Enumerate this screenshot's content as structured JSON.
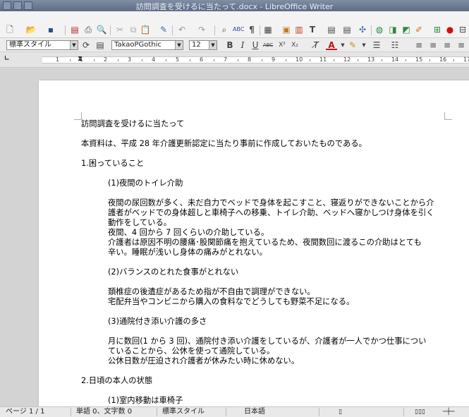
{
  "window": {
    "title": "訪問調査を受けるに当たって.docx - LibreOffice Writer"
  },
  "formatting": {
    "paragraph_style": "標準スタイル",
    "font_name": "TakaoPGothic",
    "font_size": "12",
    "bold_label": "B",
    "italic_label": "I",
    "underline_label": "U",
    "strike_label": "ABC",
    "text_color_label": "A"
  },
  "toolbar_icons": [
    "new-icon",
    "open-icon",
    "save-icon",
    "export-pdf-icon",
    "print-icon",
    "print-preview-icon",
    "cut-icon",
    "copy-icon",
    "paste-icon",
    "clone-format-icon",
    "undo-icon",
    "redo-icon",
    "find-replace-icon",
    "spelling-icon",
    "formatting-marks-icon",
    "table-icon",
    "image-icon",
    "chart-icon",
    "textbox-icon",
    "insert-field-icon",
    "footnote-icon",
    "navigator-icon",
    "hyperlink-icon",
    "comment-icon",
    "track-changes-icon",
    "record-icon"
  ],
  "ruler": {
    "numbers": [
      "1",
      "1",
      "2",
      "3",
      "4",
      "5",
      "6",
      "7",
      "8",
      "9",
      "10",
      "11",
      "12",
      "13",
      "14",
      "15",
      "16",
      "17"
    ]
  },
  "document": {
    "paragraphs": [
      {
        "text": "訪問調査を受けるに当たって",
        "indent": false
      },
      {
        "text": "",
        "indent": false
      },
      {
        "text": "本資料は、平成 28 年介護更新認定に当たり事前に作成しておいたものである。",
        "indent": false
      },
      {
        "text": "",
        "indent": false
      },
      {
        "text": "1.困っていること",
        "indent": false
      },
      {
        "text": "",
        "indent": false
      },
      {
        "text": "(1)夜間のトイレ介助",
        "indent": true
      },
      {
        "text": "",
        "indent": false
      },
      {
        "text": "夜間の尿回数が多く、未だ自力でベッドで身体を起こすこと、寝返りができないことから介",
        "indent": true
      },
      {
        "text": "護者がベッドでの身体超しと車椅子への移乗、トイレ介助、ベッドへ寝かしつけ身体を引く",
        "indent": true
      },
      {
        "text": "動作をしている。",
        "indent": true
      },
      {
        "text": "夜間、4 回から 7 回くらいの介助している。",
        "indent": true
      },
      {
        "text": "介護者は原因不明の腰痛･股関節痛を抱えているため、夜間数回に渡るこの介助はとても",
        "indent": true
      },
      {
        "text": "辛い。睡眠が浅いし身体の痛みがとれない。",
        "indent": true
      },
      {
        "text": "",
        "indent": false
      },
      {
        "text": "(2)バランスのとれた食事がとれない",
        "indent": true
      },
      {
        "text": "",
        "indent": false
      },
      {
        "text": "頚椎症の後遺症があるため指が不自由で調理ができない。",
        "indent": true
      },
      {
        "text": "宅配弁当やコンビニから購入の食料なでどうしても野菜不足になる。",
        "indent": true
      },
      {
        "text": "",
        "indent": false
      },
      {
        "text": "(3)通院付き添い介護の多さ",
        "indent": true
      },
      {
        "text": "",
        "indent": false
      },
      {
        "text": "月に数回(1 から 3 回)、通院付き添い介護をしているが、介護者が一人でかつ仕事につい",
        "indent": true
      },
      {
        "text": "ていることから、公休を使って通院している。",
        "indent": true
      },
      {
        "text": "公休日数が圧迫され介護者が休みたい時に休めない。",
        "indent": true
      },
      {
        "text": "",
        "indent": false
      },
      {
        "text": "2.日頃の本人の状態",
        "indent": false
      },
      {
        "text": "",
        "indent": false
      },
      {
        "text": "(1)室内移動は車椅子",
        "indent": true
      }
    ]
  },
  "statusbar": {
    "page": "ページ 1 / 1",
    "words": "単語 0、文字数 0",
    "style": "標準スタイル",
    "language": "日本語"
  }
}
